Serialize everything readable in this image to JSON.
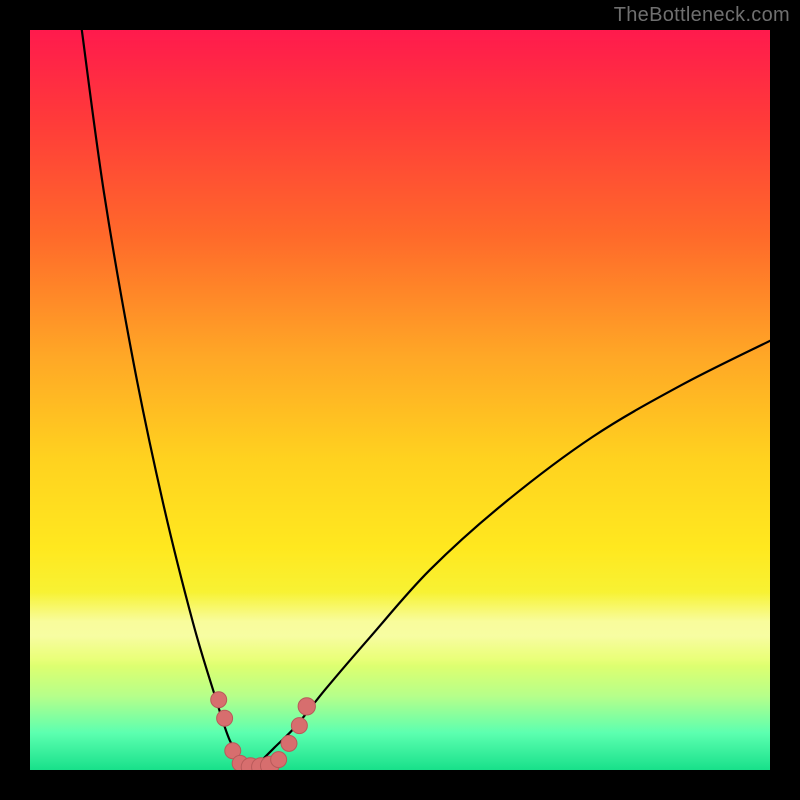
{
  "watermark": "TheBottleneck.com",
  "colors": {
    "frame": "#000000",
    "curve": "#000000",
    "marker_fill": "#d76e6e",
    "marker_stroke": "#b85a5a"
  },
  "chart_data": {
    "type": "line",
    "title": "",
    "xlabel": "",
    "ylabel": "",
    "xlim": [
      0,
      100
    ],
    "ylim": [
      0,
      100
    ],
    "grid": false,
    "legend": false,
    "note": "Bottleneck-style V curve. x is relative hardware index (0–100), y is bottleneck percentage (0–100). Minimum (~0%) near x≈30; left branch rises steeply to ~100% at x≈7; right branch rises to ~58% at x=100.",
    "series": [
      {
        "name": "bottleneck-curve",
        "x": [
          7,
          10,
          14,
          18,
          22,
          25,
          27,
          29,
          30,
          31,
          33,
          36,
          40,
          46,
          54,
          64,
          76,
          88,
          100
        ],
        "y": [
          100,
          78,
          55,
          36,
          20,
          10,
          4,
          1,
          0,
          1,
          3,
          6,
          11,
          18,
          27,
          36,
          45,
          52,
          58
        ]
      }
    ],
    "markers": [
      {
        "x": 25.5,
        "y": 9.5,
        "r": 1.2
      },
      {
        "x": 26.3,
        "y": 7.0,
        "r": 1.2
      },
      {
        "x": 27.4,
        "y": 2.6,
        "r": 1.2
      },
      {
        "x": 28.4,
        "y": 0.9,
        "r": 1.2
      },
      {
        "x": 29.8,
        "y": 0.4,
        "r": 1.4
      },
      {
        "x": 31.2,
        "y": 0.4,
        "r": 1.4
      },
      {
        "x": 32.4,
        "y": 0.6,
        "r": 1.4
      },
      {
        "x": 33.6,
        "y": 1.4,
        "r": 1.2
      },
      {
        "x": 35.0,
        "y": 3.6,
        "r": 1.2
      },
      {
        "x": 36.4,
        "y": 6.0,
        "r": 1.2
      },
      {
        "x": 37.4,
        "y": 8.6,
        "r": 1.3
      }
    ],
    "background_gradient": [
      {
        "pos": 0.0,
        "color": "#ff1a4d"
      },
      {
        "pos": 0.3,
        "color": "#ff6a2a"
      },
      {
        "pos": 0.6,
        "color": "#ffd21f"
      },
      {
        "pos": 0.85,
        "color": "#e6ff6a"
      },
      {
        "pos": 1.0,
        "color": "#18e08a"
      }
    ]
  }
}
